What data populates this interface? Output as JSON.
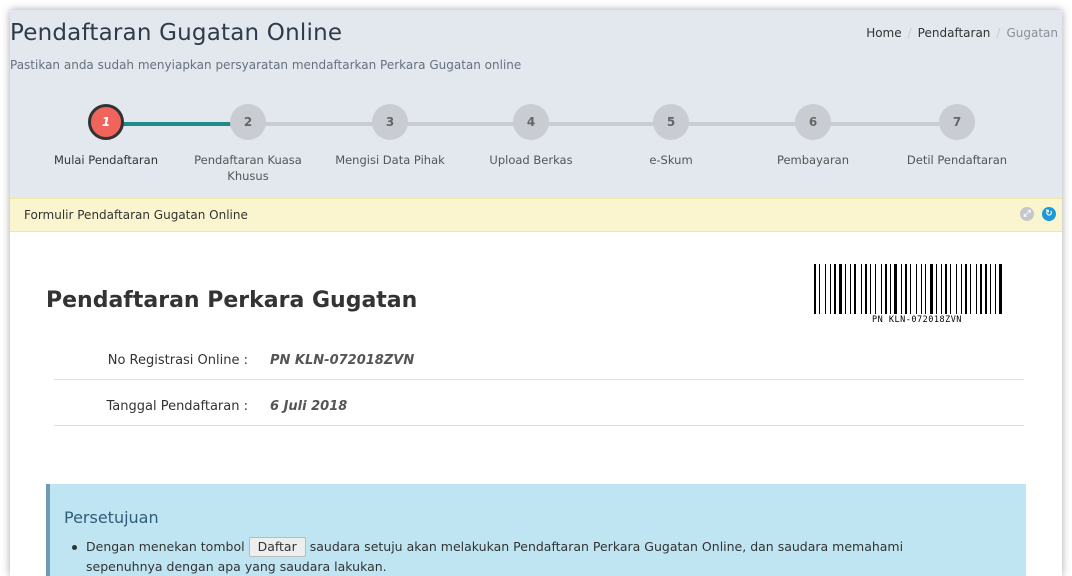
{
  "header": {
    "title": "Pendaftaran Gugatan Online",
    "subtitle": "Pastikan anda sudah menyiapkan persyaratan mendaftarkan Perkara Gugatan online"
  },
  "breadcrumb": {
    "items": [
      "Home",
      "Pendaftaran",
      "Gugatan"
    ],
    "separator": "/"
  },
  "stepper": {
    "steps": [
      {
        "number": "1",
        "label": "Mulai Pendaftaran"
      },
      {
        "number": "2",
        "label": "Pendaftaran Kuasa Khusus"
      },
      {
        "number": "3",
        "label": "Mengisi Data Pihak"
      },
      {
        "number": "4",
        "label": "Upload Berkas"
      },
      {
        "number": "5",
        "label": "e-Skum"
      },
      {
        "number": "6",
        "label": "Pembayaran"
      },
      {
        "number": "7",
        "label": "Detil Pendaftaran"
      }
    ],
    "active_step": 1
  },
  "panel": {
    "title": "Formulir Pendaftaran Gugatan Online",
    "tools": [
      {
        "icon": "expand-icon",
        "glyph": "⤢"
      },
      {
        "icon": "reload-icon",
        "glyph": "↻"
      }
    ]
  },
  "form": {
    "title": "Pendaftaran Perkara Gugatan",
    "barcode_text": "PN KLN-072018ZVN",
    "rows": [
      {
        "label": "No Registrasi Online :",
        "value": "PN KLN-072018ZVN"
      },
      {
        "label": "Tanggal Pendaftaran :",
        "value": "6 Juli 2018"
      }
    ]
  },
  "consent": {
    "title": "Persetujuan",
    "item1_before": "Dengan menekan tombol",
    "button_label": "Daftar",
    "item1_after": "saudara setuju akan melakukan Pendaftaran Perkara Gugatan Online, dan saudara memahami sepenuhnya dengan apa yang saudara lakukan."
  },
  "colors": {
    "active_step": "#f0645c",
    "progress": "#1f8c8a",
    "panel_header": "#fbf5cf",
    "consent_bg": "#bfe5f2"
  }
}
